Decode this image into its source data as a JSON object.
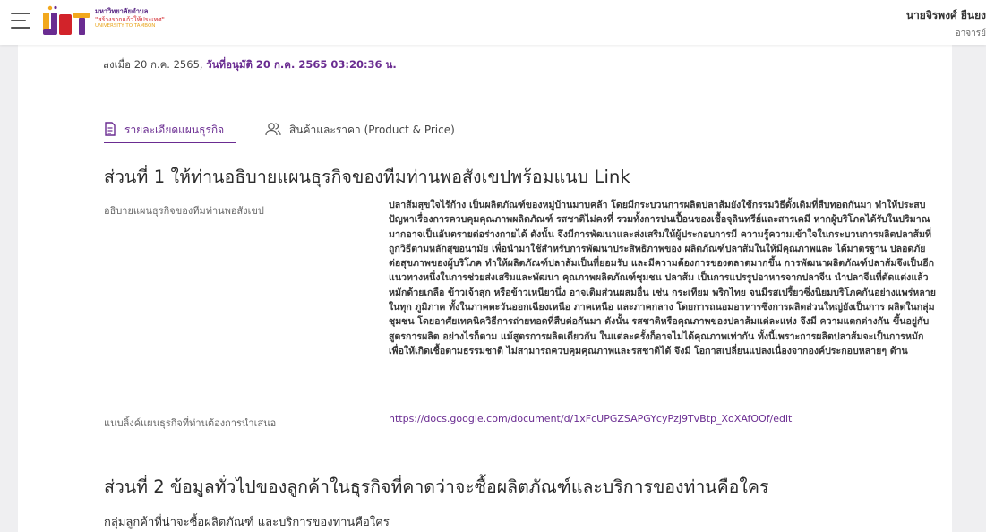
{
  "header": {
    "logo": {
      "mark": "U2T",
      "line1": "มหาวิทยาลัยตำบล",
      "line2": "\"สร้างรากแก้วให้ประเทศ\"",
      "line3": "UNIVERSITY TO TAMBON",
      "colors": {
        "purple": "#6a2c91",
        "orange": "#f2a81d",
        "red": "#d2232a"
      }
    },
    "user": {
      "name": "นายจิรพงศ์ ยืนยง",
      "role": "อาจารย์"
    },
    "menu_icon": "hamburger-icon"
  },
  "record": {
    "submitted_text": "ส่งเมื่อ 20 ก.ค. 2565,",
    "approved_text": "วันที่อนุมัติ 20 ก.ค. 2565 03:20:36 น."
  },
  "tabs": [
    {
      "label": "รายละเอียดแผนธุรกิจ",
      "icon": "document-icon",
      "active": true
    },
    {
      "label": "สินค้าและราคา (Product & Price)",
      "icon": "users-icon",
      "active": false
    }
  ],
  "section1": {
    "title": "ส่วนที่ 1 ให้ท่านอธิบายแผนธุรกิจของทีมท่านพอสังเขปพร้อมแนบ Link",
    "description_label": "อธิบายแผนธุรกิจของทีมท่านพอสังเขป",
    "description": "ปลาส้มสุขใจไร้ก้าง เป็นผลิตภัณฑ์ของหมู่บ้านมาบคล้า โดยมีกระบวนการผลิตปลาส้มยังใช้กรรมวิธีดั้งเดิมที่สืบทอดกันมา ทำให้ประสบปัญหาเรื่องการควบคุมคุณภาพผลิตภัณฑ์ รสชาติไม่คงที่ รวมทั้งการปนเปื้อนของเชื้อจุลินทรีย์และสารเคมี หากผู้บริโภคได้รับในปริมาณมากอาจเป็นอันตรายต่อร่างกายได้ ดังนั้น จึงมีการพัฒนาและส่งเสริมให้ผู้ประกอบการมี ความรู้ความเข้าใจในกระบวนการผลิตปลาส้มที่ถูกวิธีตามหลักสุขอนามัย เพื่อนำมาใช้สำหรับการพัฒนาประสิทธิภาพของ ผลิตภัณฑ์ปลาส้มในให้มีคุณภาพและ ได้มาตรฐาน ปลอดภัยต่อสุขภาพของผู้บริโภค ทำให้ผลิตภัณฑ์ปลาส้มเป็นที่ยอมรับ และมีความต้องการของตลาดมากขึ้น การพัฒนาผลิตภัณฑ์ปลาส้มจึงเป็นอีกแนวทางหนึ่งในการช่วยส่งเสริมและพัฒนา คุณภาพผลิตภัณฑ์ชุมชน ปลาส้ม เป็นการแปรรูปอาหารจากปลาจีน นำปลาจีนที่ตัดแต่งแล้วหมักด้วยเกลือ ข้าวเจ้าสุก หรือข้าวเหนียวนึ่ง อาจเติมส่วนผสมอื่น เช่น กระเทียม พริกไทย จนมีรสเปรี้ยวซึ่งนิยมบริโภคกันอย่างแพร่หลาย ในทุก ภูมิภาค ทั้งในภาคตะวันออกเฉียงเหนือ ภาคเหนือ และภาคกลาง โดยการถนอมอาหารซึ่งการผลิตส่วนใหญ่ยังเป็นการ ผลิตในกลุ่มชุมชน โดยอาศัยเทคนิควิธีการถ่ายทอดที่สืบต่อกันมา ดังนั้น รสชาติหรือคุณภาพของปลาส้มแต่ละแห่ง จึงมี ความแตกต่างกัน ขึ้นอยู่กับสูตรการผลิต อย่างไรก็ตาม แม้สูตรการผลิตเดียวกัน ในแต่ละครั้งก็อาจไม่ได้คุณภาพเท่ากัน ทั้งนี้เพราะการผลิตปลาส้มจะเป็นการหมักเพื่อให้เกิดเชื้อตามธรรมชาติ ไม่สามารถควบคุมคุณภาพและรสชาติได้ จึงมี โอกาสเปลี่ยนแปลงเนื่องจากองค์ประกอบหลายๆ ด้าน",
    "link_label": "แนบลิ้งค์แผนธุรกิจที่ท่านต้องการนำเสนอ",
    "link": "https://docs.google.com/document/d/1xFcUPGZSAPGYcyPzj9TvBtp_XoXAfOOf/edit"
  },
  "section2": {
    "title": "ส่วนที่ 2 ข้อมูลทั่วไปของลูกค้าในธุรกิจที่คาดว่าจะซื้อผลิตภัณฑ์และบริการของท่านคือใคร",
    "subtitle": "กลุ่มลูกค้าที่น่าจะซื้อผลิตภัณฑ์ และบริการของท่านคือใคร"
  }
}
